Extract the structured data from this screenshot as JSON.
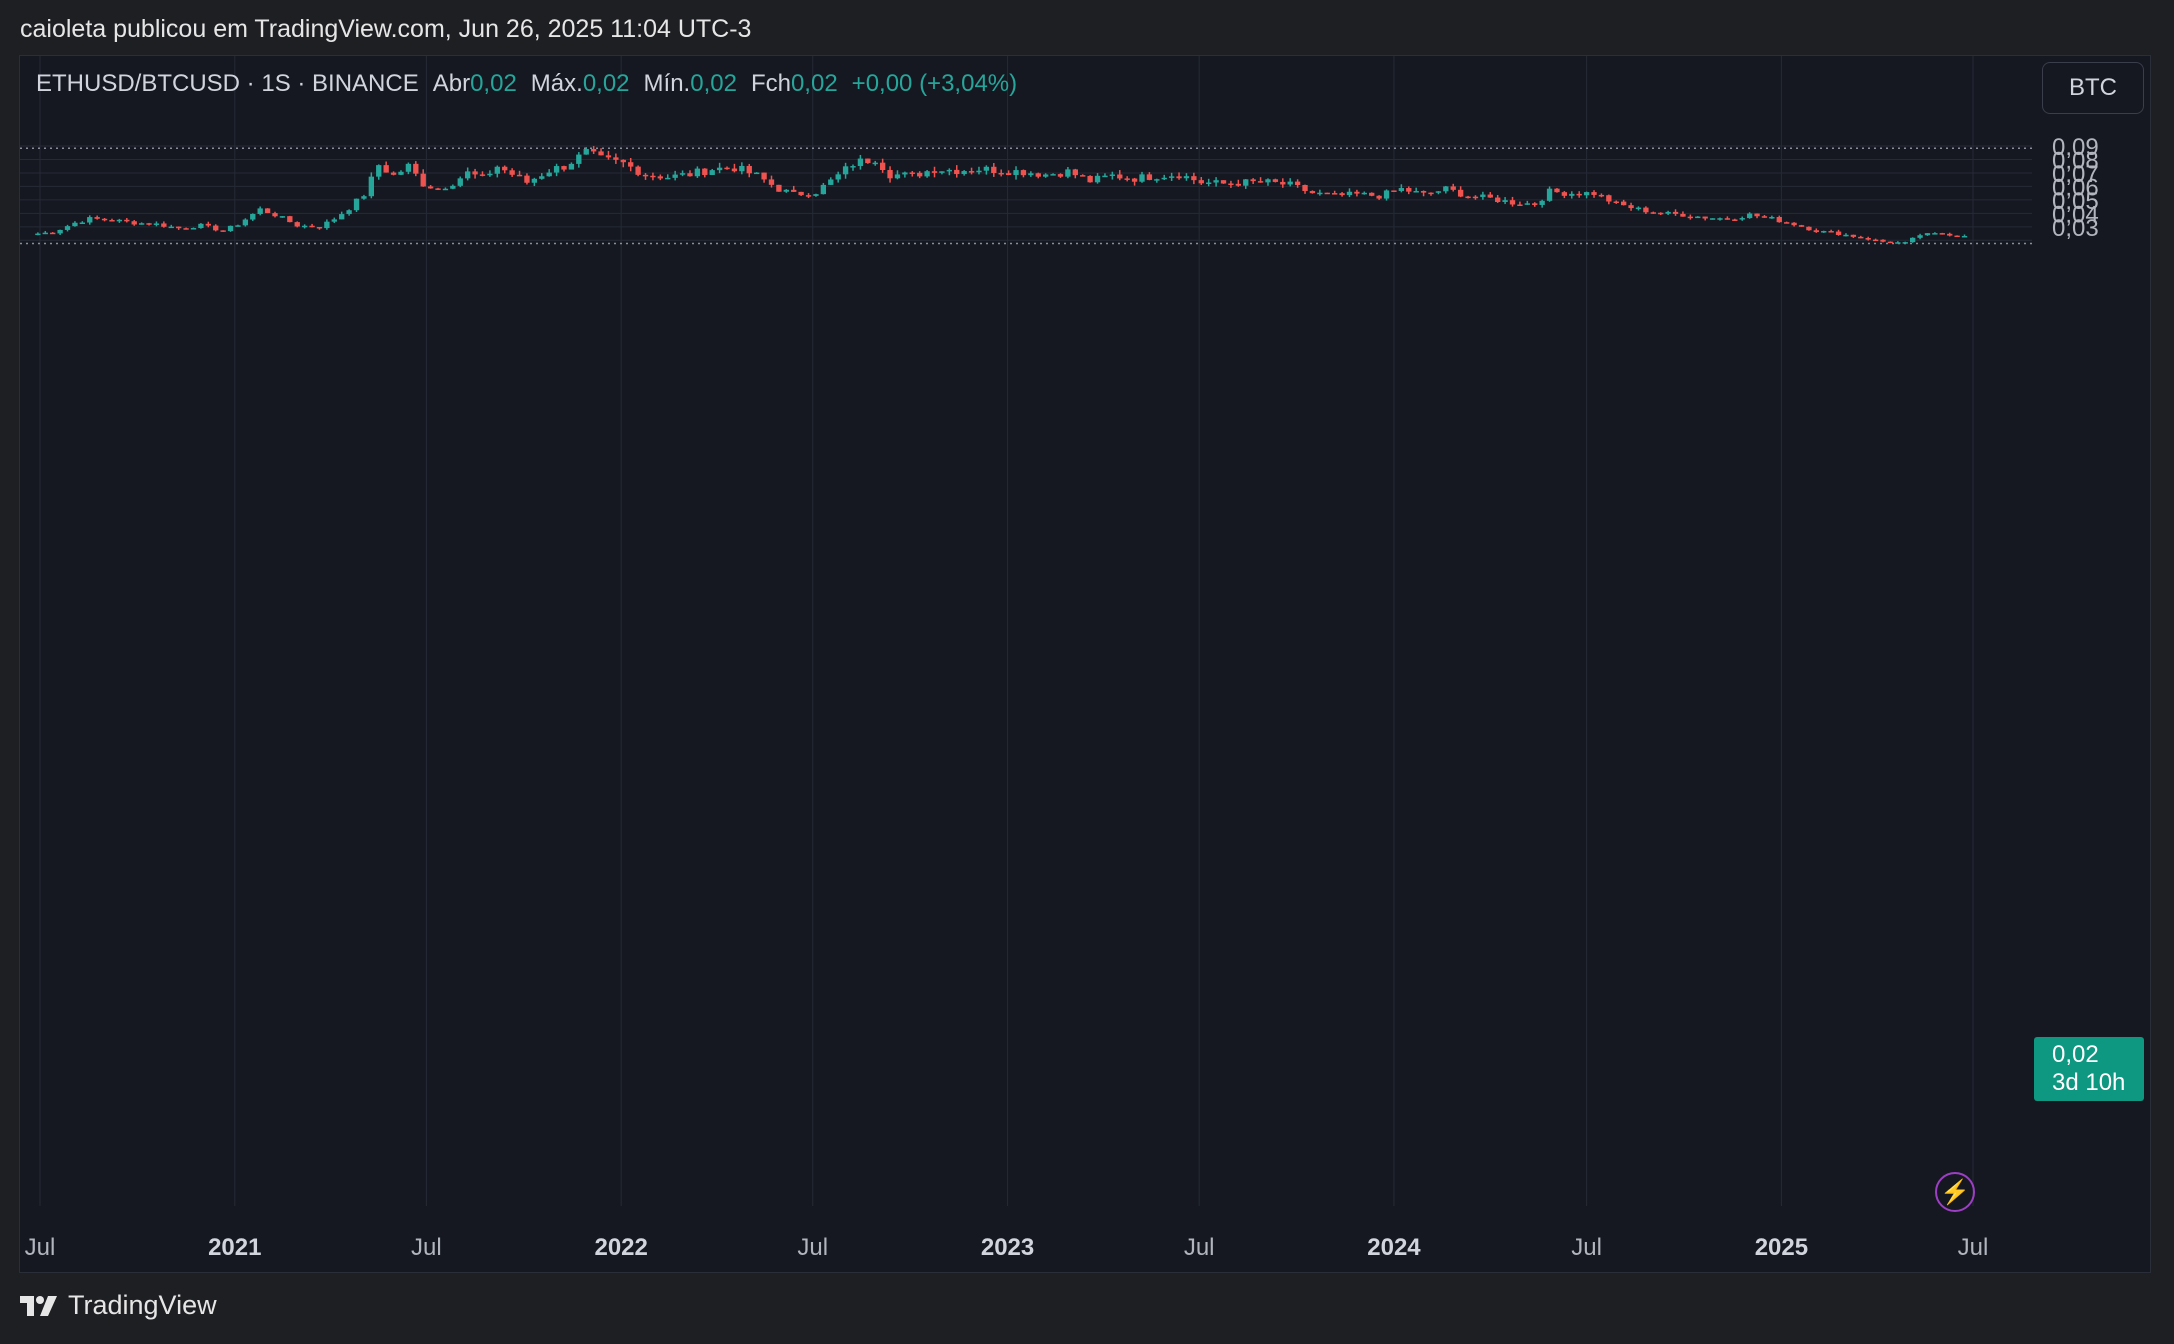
{
  "header": {
    "publish_text": "caioleta publicou em TradingView.com, Jun 26, 2025 11:04 UTC-3"
  },
  "legend": {
    "symbol": "ETHUSD/BTCUSD · 1S · BINANCE",
    "open_label": "Abr",
    "open_value": "0,02",
    "high_label": "Máx.",
    "high_value": "0,02",
    "low_label": "Mín.",
    "low_value": "0,02",
    "close_label": "Fch",
    "close_value": "0,02",
    "change": "+0,00 (+3,04%)"
  },
  "currency_button": "BTC",
  "last_price": {
    "value": "0,02",
    "countdown": "3d 10h"
  },
  "brand": "TradingView",
  "colors": {
    "up": "#26a69a",
    "down": "#ef5350",
    "background": "#151821",
    "grid": "#262a35",
    "axis_text": "#b2b5be",
    "accent_tag": "#0e9781"
  },
  "chart_data": {
    "type": "candlestick",
    "interval": "weekly",
    "ylim": [
      0.015,
      0.095
    ],
    "y_ticks": [
      "0,09",
      "0,08",
      "0,07",
      "0,06",
      "0,05",
      "0,04",
      "0,03"
    ],
    "y_tick_values": [
      0.09,
      0.08,
      0.07,
      0.06,
      0.05,
      0.04,
      0.03
    ],
    "x_ticks": [
      "Jul",
      "2021",
      "Jul",
      "2022",
      "Jul",
      "2023",
      "Jul",
      "2024",
      "Jul",
      "2025",
      "Jul"
    ],
    "x_tick_dates": [
      "2020-07-01",
      "2021-01-01",
      "2021-07-01",
      "2022-01-01",
      "2022-07-01",
      "2023-01-01",
      "2023-07-01",
      "2024-01-01",
      "2024-07-01",
      "2025-01-01",
      "2025-07-01"
    ],
    "bold_ticks": [
      "2021",
      "2022",
      "2023",
      "2024",
      "2025"
    ],
    "all_time_high": 0.0883,
    "period_low": 0.0176,
    "last_close": 0.0232,
    "close_path": [
      [
        "2020-06-29",
        0.025
      ],
      [
        "2020-07-13",
        0.026
      ],
      [
        "2020-08-03",
        0.033
      ],
      [
        "2020-08-17",
        0.036
      ],
      [
        "2020-09-07",
        0.035
      ],
      [
        "2020-09-28",
        0.033
      ],
      [
        "2020-10-19",
        0.032
      ],
      [
        "2020-11-09",
        0.029
      ],
      [
        "2020-11-30",
        0.031
      ],
      [
        "2020-12-21",
        0.027
      ],
      [
        "2021-01-04",
        0.032
      ],
      [
        "2021-01-25",
        0.043
      ],
      [
        "2021-02-08",
        0.039
      ],
      [
        "2021-03-01",
        0.031
      ],
      [
        "2021-03-22",
        0.03
      ],
      [
        "2021-04-05",
        0.036
      ],
      [
        "2021-04-19",
        0.044
      ],
      [
        "2021-05-03",
        0.054
      ],
      [
        "2021-05-17",
        0.076
      ],
      [
        "2021-05-31",
        0.068
      ],
      [
        "2021-06-14",
        0.075
      ],
      [
        "2021-06-28",
        0.062
      ],
      [
        "2021-07-12",
        0.058
      ],
      [
        "2021-07-26",
        0.063
      ],
      [
        "2021-08-09",
        0.07
      ],
      [
        "2021-08-23",
        0.066
      ],
      [
        "2021-09-06",
        0.075
      ],
      [
        "2021-09-20",
        0.069
      ],
      [
        "2021-10-04",
        0.063
      ],
      [
        "2021-10-25",
        0.072
      ],
      [
        "2021-11-08",
        0.075
      ],
      [
        "2021-11-29",
        0.085
      ],
      [
        "2021-12-13",
        0.08
      ],
      [
        "2022-01-03",
        0.077
      ],
      [
        "2022-01-24",
        0.069
      ],
      [
        "2022-02-14",
        0.067
      ],
      [
        "2022-03-07",
        0.069
      ],
      [
        "2022-03-28",
        0.073
      ],
      [
        "2022-04-18",
        0.074
      ],
      [
        "2022-05-09",
        0.068
      ],
      [
        "2022-05-30",
        0.058
      ],
      [
        "2022-06-13",
        0.054
      ],
      [
        "2022-07-04",
        0.056
      ],
      [
        "2022-07-25",
        0.068
      ],
      [
        "2022-08-08",
        0.077
      ],
      [
        "2022-08-29",
        0.081
      ],
      [
        "2022-09-12",
        0.069
      ],
      [
        "2022-10-03",
        0.068
      ],
      [
        "2022-10-24",
        0.073
      ],
      [
        "2022-11-14",
        0.072
      ],
      [
        "2022-12-05",
        0.073
      ],
      [
        "2022-12-26",
        0.072
      ],
      [
        "2023-01-16",
        0.071
      ],
      [
        "2023-02-06",
        0.069
      ],
      [
        "2023-02-27",
        0.071
      ],
      [
        "2023-03-20",
        0.064
      ],
      [
        "2023-04-10",
        0.068
      ],
      [
        "2023-05-01",
        0.066
      ],
      [
        "2023-05-22",
        0.068
      ],
      [
        "2023-06-12",
        0.069
      ],
      [
        "2023-07-03",
        0.063
      ],
      [
        "2023-07-24",
        0.062
      ],
      [
        "2023-08-14",
        0.063
      ],
      [
        "2023-09-04",
        0.063
      ],
      [
        "2023-09-25",
        0.061
      ],
      [
        "2023-10-16",
        0.055
      ],
      [
        "2023-11-06",
        0.053
      ],
      [
        "2023-11-27",
        0.054
      ],
      [
        "2023-12-18",
        0.053
      ],
      [
        "2024-01-08",
        0.058
      ],
      [
        "2024-01-29",
        0.054
      ],
      [
        "2024-02-19",
        0.058
      ],
      [
        "2024-03-11",
        0.053
      ],
      [
        "2024-04-01",
        0.051
      ],
      [
        "2024-04-22",
        0.048
      ],
      [
        "2024-05-13",
        0.047
      ],
      [
        "2024-05-27",
        0.056
      ],
      [
        "2024-06-17",
        0.055
      ],
      [
        "2024-07-08",
        0.055
      ],
      [
        "2024-07-29",
        0.047
      ],
      [
        "2024-08-19",
        0.043
      ],
      [
        "2024-09-09",
        0.04
      ],
      [
        "2024-09-30",
        0.039
      ],
      [
        "2024-10-21",
        0.037
      ],
      [
        "2024-11-11",
        0.036
      ],
      [
        "2024-12-02",
        0.039
      ],
      [
        "2024-12-23",
        0.036
      ],
      [
        "2025-01-13",
        0.032
      ],
      [
        "2025-02-03",
        0.027
      ],
      [
        "2025-02-24",
        0.025
      ],
      [
        "2025-03-17",
        0.022
      ],
      [
        "2025-04-07",
        0.019
      ],
      [
        "2025-04-28",
        0.018
      ],
      [
        "2025-05-12",
        0.024
      ],
      [
        "2025-06-02",
        0.025
      ],
      [
        "2025-06-23",
        0.0232
      ]
    ]
  }
}
